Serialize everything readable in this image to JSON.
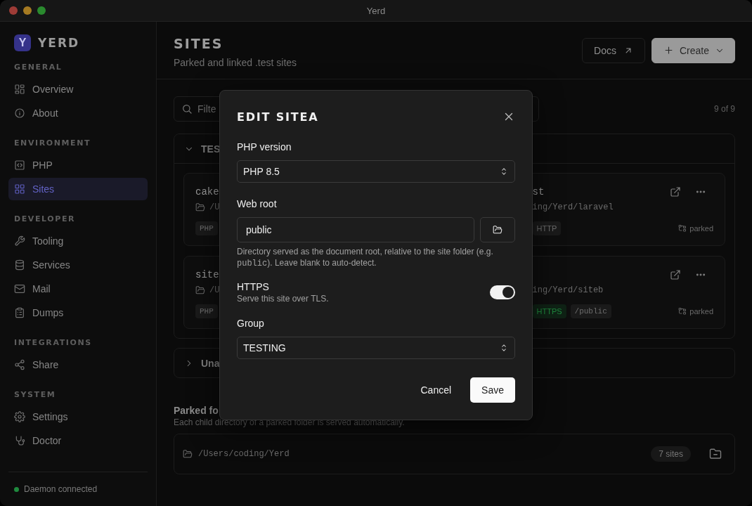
{
  "window": {
    "title": "Yerd"
  },
  "sidebar": {
    "brand": {
      "logo": "Y",
      "name": "YERD"
    },
    "sections": [
      {
        "heading": "GENERAL",
        "items": [
          {
            "label": "Overview",
            "selected": false
          },
          {
            "label": "About",
            "selected": false
          }
        ]
      },
      {
        "heading": "ENVIRONMENT",
        "items": [
          {
            "label": "PHP",
            "selected": false
          },
          {
            "label": "Sites",
            "selected": true
          }
        ]
      },
      {
        "heading": "DEVELOPER",
        "items": [
          {
            "label": "Tooling",
            "selected": false
          },
          {
            "label": "Services",
            "selected": false
          },
          {
            "label": "Mail",
            "selected": false
          },
          {
            "label": "Dumps",
            "selected": false
          }
        ]
      },
      {
        "heading": "INTEGRATIONS",
        "items": [
          {
            "label": "Share",
            "selected": false
          }
        ]
      },
      {
        "heading": "SYSTEM",
        "items": [
          {
            "label": "Settings",
            "selected": false
          },
          {
            "label": "Doctor",
            "selected": false
          }
        ]
      }
    ],
    "status": {
      "text": "Daemon connected",
      "connected": true
    }
  },
  "header": {
    "title": "SITES",
    "subtitle": "Parked and linked .test sites",
    "buttons": [
      {
        "label": "Docs",
        "kind": "secondary"
      },
      {
        "label": "Create",
        "kind": "primary"
      }
    ]
  },
  "filter": {
    "placeholder": "Filte",
    "count": "9 of 9"
  },
  "groups": [
    {
      "name": "TES",
      "expanded": true,
      "sites": [
        {
          "name": "cake",
          "path": "/U",
          "tags": [
            {
              "text": "PHP",
              "kind": "mono"
            }
          ]
        },
        {
          "name": "st",
          "path": "ing/Yerd/laravel",
          "tags": [
            {
              "text": "HTTP",
              "kind": "plain"
            }
          ],
          "status": "parked"
        },
        {
          "name": "site",
          "path": "/U",
          "tags": [
            {
              "text": "PHP",
              "kind": "mono"
            }
          ]
        },
        {
          "path": "ing/Yerd/siteb",
          "tags": [
            {
              "text": "HTTPS",
              "kind": "secure"
            },
            {
              "text": "/public",
              "kind": "mono"
            }
          ],
          "status": "parked"
        }
      ]
    },
    {
      "name": "Una",
      "expanded": false
    }
  ],
  "parked": {
    "heading": "Parked fo",
    "description": "Each child directory of a parked folder is served automatically.",
    "folders": [
      {
        "path": "/Users/coding/Yerd",
        "count": "7 sites"
      }
    ]
  },
  "dialog": {
    "title": "EDIT SITEA",
    "php": {
      "label": "PHP version",
      "value": "PHP 8.5"
    },
    "web_root": {
      "label": "Web root",
      "value": "public",
      "help": {
        "before": "Directory served as the document root, relative to the site folder (e.g. ",
        "code": "public",
        "after": "). Leave blank to auto-detect."
      }
    },
    "https": {
      "label": "HTTPS",
      "description": "Serve this site over TLS.",
      "on": true
    },
    "group": {
      "label": "Group",
      "value": "TESTING"
    },
    "buttons": [
      {
        "label": "Cancel",
        "kind": "ghost"
      },
      {
        "label": "Save",
        "kind": "primary"
      }
    ]
  }
}
